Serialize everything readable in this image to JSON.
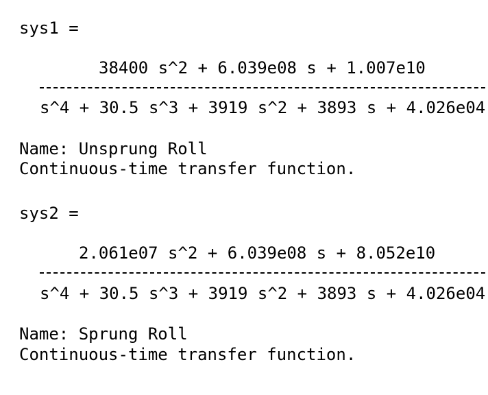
{
  "systems": [
    {
      "label": "sys1 =",
      "numerator": "38400 s^2 + 6.039e08 s + 1.007e10",
      "denominator": "s^4 + 30.5 s^3 + 3919 s^2 + 3893 s + 4.026e04",
      "name_line": "Name: Unsprung Roll",
      "type_line": "Continuous-time transfer function."
    },
    {
      "label": "sys2 =",
      "numerator": "2.061e07 s^2 + 6.039e08 s + 8.052e10",
      "denominator": "s^4 + 30.5 s^3 + 3919 s^2 + 3893 s + 4.026e04",
      "name_line": "Name: Sprung Roll",
      "type_line": "Continuous-time transfer function."
    }
  ]
}
